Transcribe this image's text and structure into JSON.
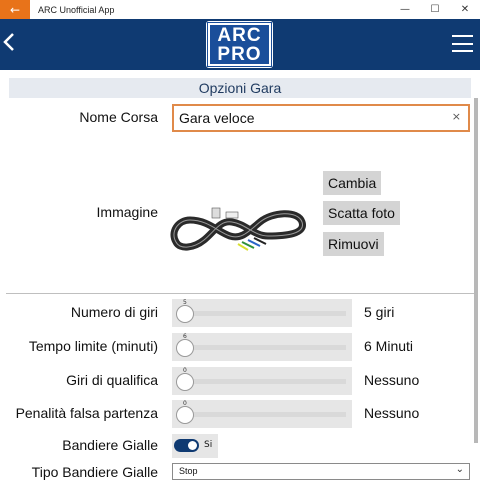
{
  "window": {
    "title": "ARC Unofficial App",
    "minimize": "—",
    "maximize": "☐",
    "close": "✕",
    "back": "←"
  },
  "header": {
    "back": "‹",
    "logo_line1": "ARC",
    "logo_line2": "PRO"
  },
  "section": {
    "title": "Opzioni Gara"
  },
  "race_name": {
    "label": "Nome Corsa",
    "value": "Gara veloce",
    "clear": "×"
  },
  "image": {
    "label": "Immagine",
    "buttons": {
      "change": "Cambia",
      "photo": "Scatta foto",
      "remove": "Rimuovi"
    }
  },
  "laps": {
    "label": "Numero di giri",
    "tick": "5",
    "value": "5 giri",
    "level": 5
  },
  "time_limit": {
    "label": "Tempo limite (minuti)",
    "tick": "6",
    "value": "6 Minuti",
    "level": 6
  },
  "qualifying": {
    "label": "Giri di qualifica",
    "tick": "0",
    "value": "Nessuno",
    "level": 0
  },
  "false_start": {
    "label": "Penalità falsa partenza",
    "tick": "0",
    "value": "Nessuno",
    "level": 0
  },
  "yellow_flags": {
    "label": "Bandiere Gialle",
    "state": "Si",
    "on": true
  },
  "yellow_flag_type": {
    "label": "Tipo Bandiere Gialle",
    "value": "Stop",
    "chevron": "⌄"
  },
  "colors": {
    "header": "#0f3a72",
    "accent": "#e8731a",
    "input_border": "#e08a4a"
  }
}
